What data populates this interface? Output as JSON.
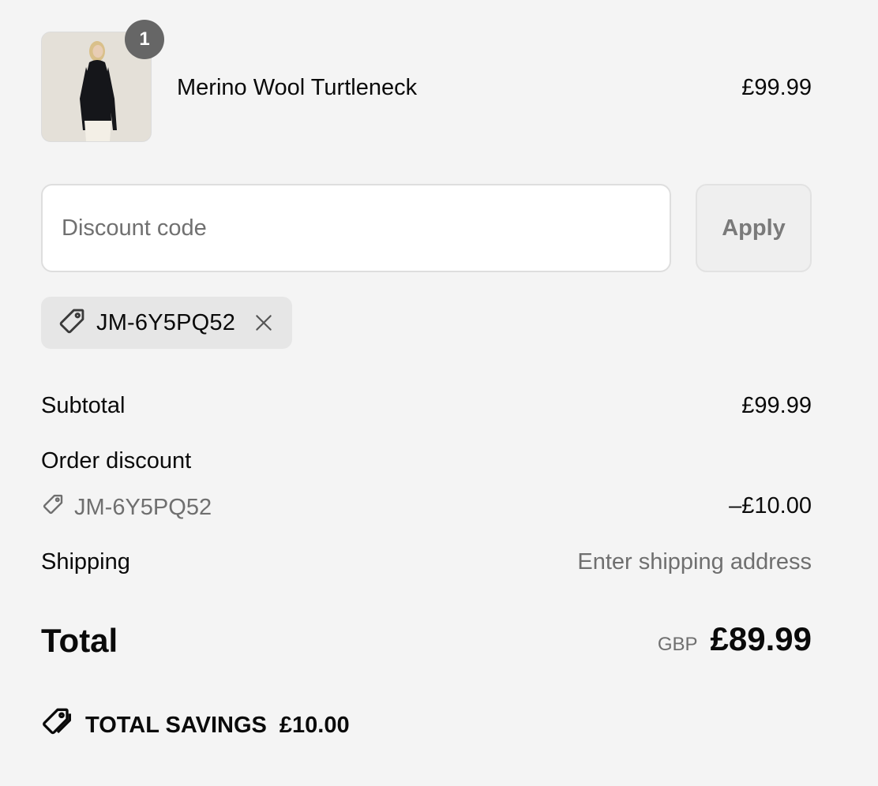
{
  "product": {
    "quantity_badge": "1",
    "name": "Merino Wool Turtleneck",
    "price": "£99.99",
    "image_icon": "product-photo"
  },
  "discount": {
    "placeholder": "Discount code",
    "apply_label": "Apply",
    "applied_code": "JM-6Y5PQ52",
    "tag_icon": "tag-icon",
    "remove_icon": "close-icon"
  },
  "summary": {
    "subtotal_label": "Subtotal",
    "subtotal_value": "£99.99",
    "order_discount_label": "Order discount",
    "order_discount_code": "JM-6Y5PQ52",
    "order_discount_value": "–£10.00",
    "shipping_label": "Shipping",
    "shipping_value": "Enter shipping address",
    "total_label": "Total",
    "total_currency": "GBP",
    "total_amount": "£89.99",
    "savings_label": "TOTAL SAVINGS",
    "savings_amount": "£10.00"
  },
  "colors": {
    "background": "#f4f4f4",
    "badge": "#666666",
    "muted_text": "#6f6f6f",
    "chip_background": "#e6e6e6"
  }
}
